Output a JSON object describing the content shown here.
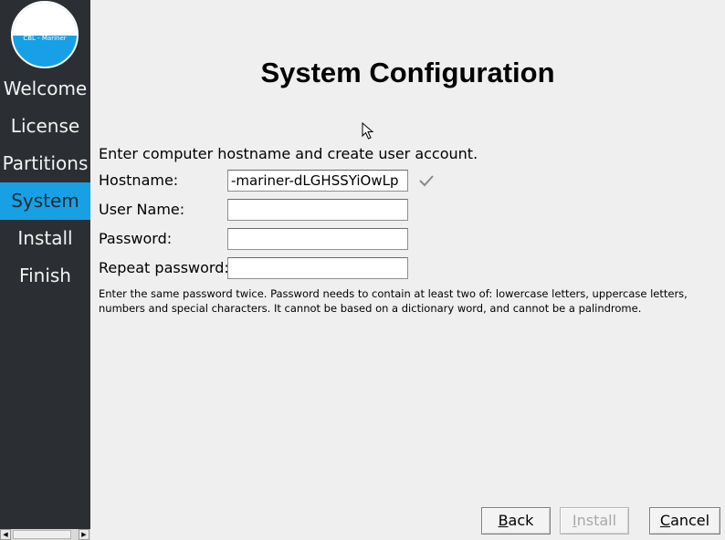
{
  "logo": {
    "text": "CBL - Mariner"
  },
  "sidebar": {
    "items": [
      {
        "label": "Welcome"
      },
      {
        "label": "License"
      },
      {
        "label": "Partitions"
      },
      {
        "label": "System",
        "active": true
      },
      {
        "label": "Install"
      },
      {
        "label": "Finish"
      }
    ]
  },
  "page": {
    "title": "System Configuration",
    "intro": "Enter computer hostname and create user account.",
    "hint": "Enter the same password twice. Password needs to contain at least two of: lowercase letters, uppercase letters, numbers and special characters. It cannot be based on a dictionary word, and cannot be a palindrome."
  },
  "form": {
    "hostname": {
      "label": "Hostname:",
      "value": "-mariner-dLGHSSYiOwLp",
      "valid_icon": "checkmark-icon"
    },
    "username": {
      "label": "User Name:",
      "value": ""
    },
    "password": {
      "label": "Password:",
      "value": ""
    },
    "repeat_password": {
      "label": "Repeat password:",
      "value": ""
    }
  },
  "buttons": {
    "back": {
      "mnemonic": "B",
      "rest": "ack"
    },
    "install": {
      "mnemonic": "I",
      "rest": "nstall",
      "disabled": true
    },
    "cancel": {
      "mnemonic": "C",
      "rest": "ancel"
    }
  },
  "colors": {
    "sidebar_bg": "#2b2f33",
    "accent": "#18a0e4",
    "content_bg": "#efefef"
  }
}
